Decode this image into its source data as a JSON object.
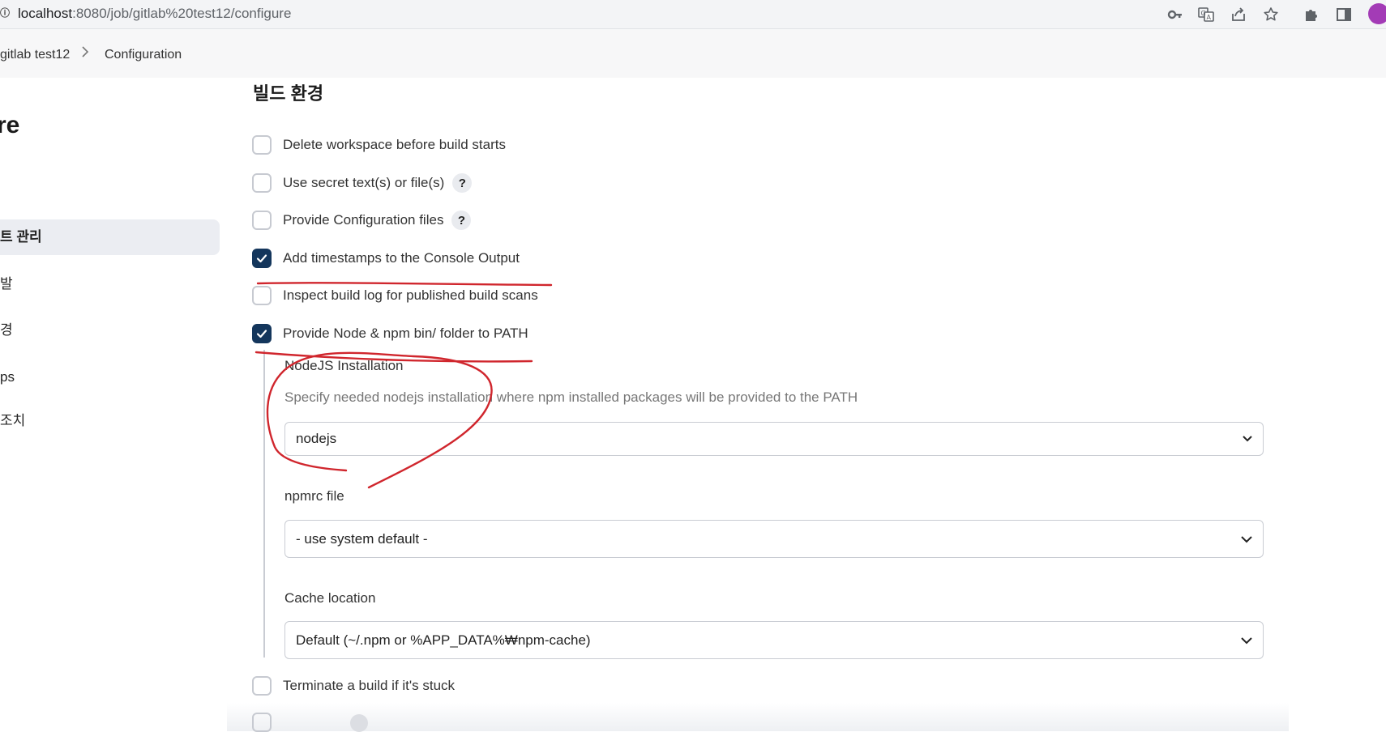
{
  "browser": {
    "url_host": "localhost",
    "url_path": ":8080/job/gitlab%20test12/configure",
    "icons": [
      "key-icon",
      "translate-icon",
      "share-icon",
      "star-icon",
      "extensions-icon",
      "sidepanel-icon",
      "profile-avatar"
    ]
  },
  "breadcrumb": {
    "items": [
      "gitlab test12",
      "Configuration"
    ],
    "separator": ">"
  },
  "sidebar": {
    "title": "re",
    "items": [
      {
        "label": "트 관리",
        "active": true
      },
      {
        "label": "발"
      },
      {
        "label": "경"
      },
      {
        "label": "ps"
      },
      {
        "label": "조치"
      }
    ]
  },
  "main": {
    "section_title": "빌드 환경",
    "options": [
      {
        "label": "Delete workspace before build starts",
        "checked": false,
        "help": false
      },
      {
        "label": "Use secret text(s) or file(s)",
        "checked": false,
        "help": true
      },
      {
        "label": "Provide Configuration files",
        "checked": false,
        "help": true
      },
      {
        "label": "Add timestamps to the Console Output",
        "checked": true,
        "help": false
      },
      {
        "label": "Inspect build log for published build scans",
        "checked": false,
        "help": false
      },
      {
        "label": "Provide Node & npm bin/ folder to PATH",
        "checked": true,
        "help": false
      },
      {
        "label": "Terminate a build if it's stuck",
        "checked": false,
        "help": false
      }
    ],
    "help_glyph": "?",
    "nodejs": {
      "label": "NodeJS Installation",
      "description": "Specify needed nodejs installation where npm installed packages will be provided to the PATH",
      "value": "nodejs"
    },
    "npmrc": {
      "label": "npmrc file",
      "value": "- use system default -"
    },
    "cache": {
      "label": "Cache location",
      "value": "Default (~/.npm or %APP_DATA%₩npm-cache)"
    }
  },
  "annotation_color": "#d0262d",
  "accent_color": "#14365c"
}
